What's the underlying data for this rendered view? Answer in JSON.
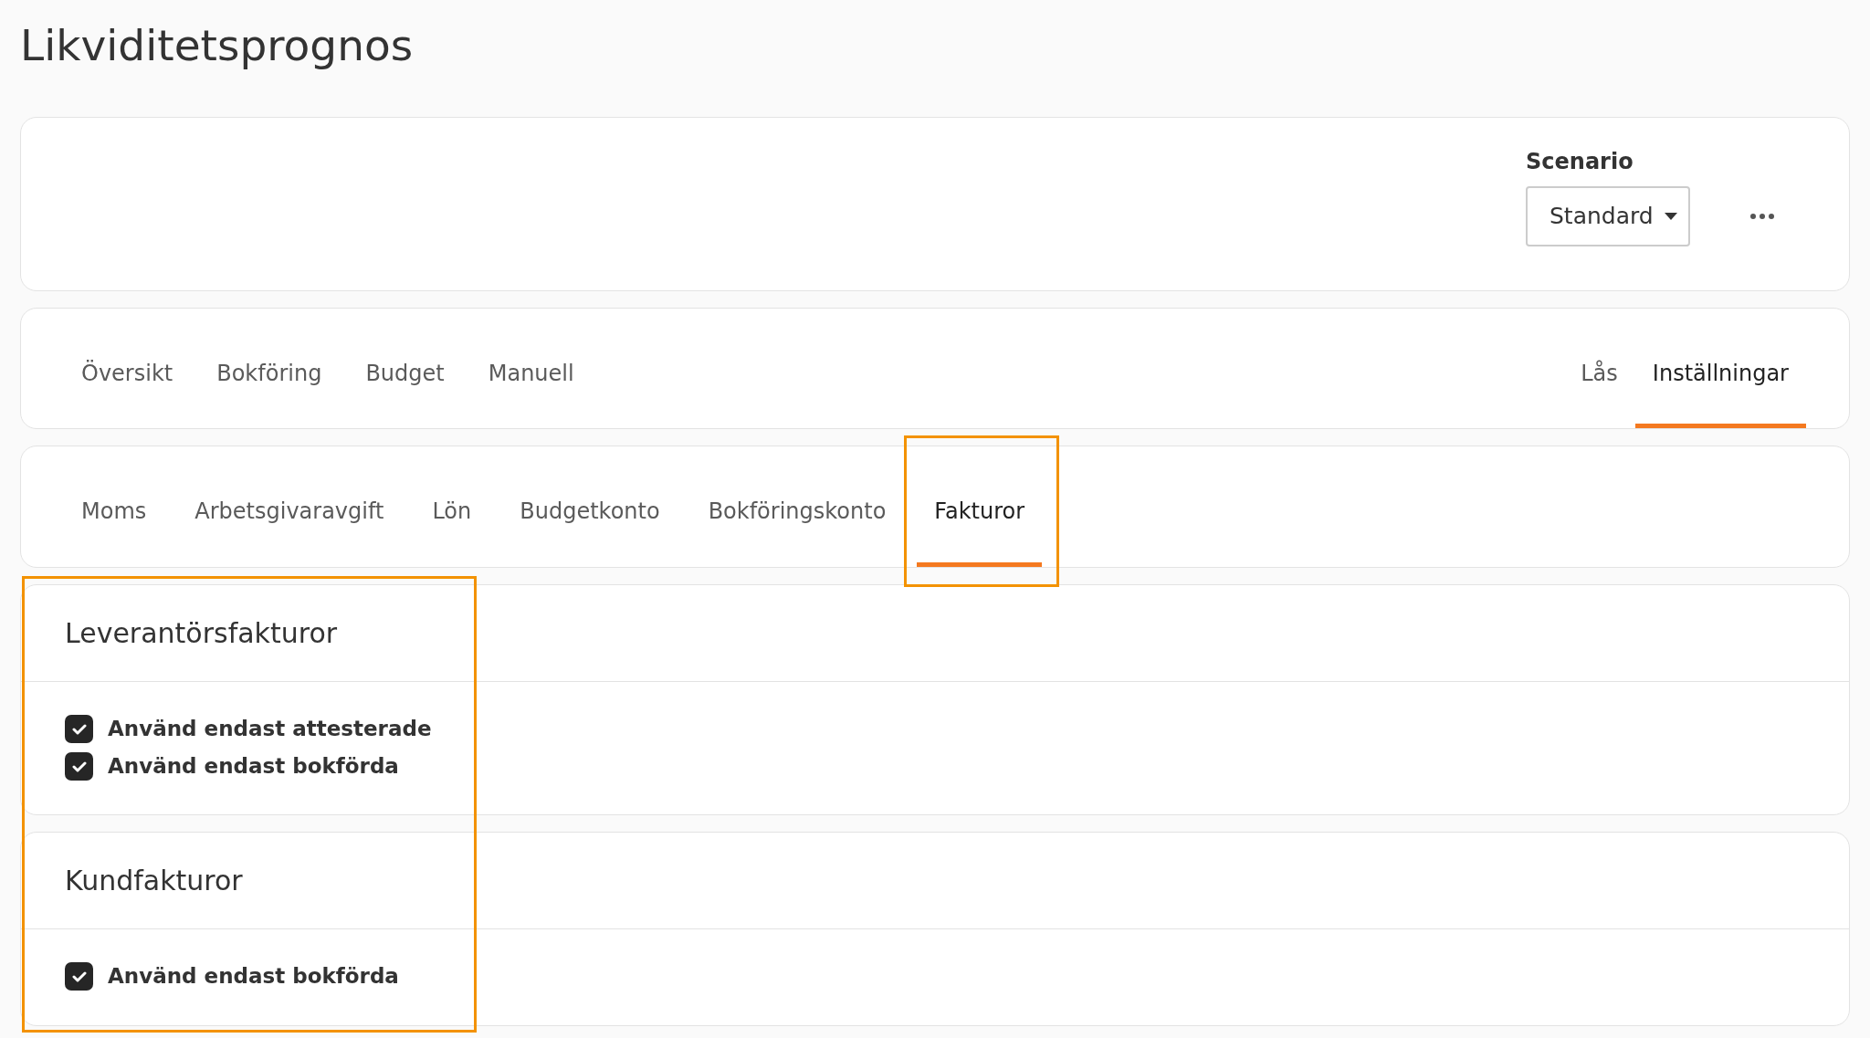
{
  "page": {
    "title": "Likviditetsprognos"
  },
  "scenario": {
    "label": "Scenario",
    "value": "Standard"
  },
  "main_tabs": {
    "left": [
      {
        "label": "Översikt",
        "selected": false
      },
      {
        "label": "Bokföring",
        "selected": false
      },
      {
        "label": "Budget",
        "selected": false
      },
      {
        "label": "Manuell",
        "selected": false
      }
    ],
    "right": [
      {
        "label": "Lås",
        "selected": false
      },
      {
        "label": "Inställningar",
        "selected": true
      }
    ]
  },
  "sub_tabs": [
    {
      "label": "Moms",
      "selected": false
    },
    {
      "label": "Arbetsgivaravgift",
      "selected": false
    },
    {
      "label": "Lön",
      "selected": false
    },
    {
      "label": "Budgetkonto",
      "selected": false
    },
    {
      "label": "Bokföringskonto",
      "selected": false
    },
    {
      "label": "Fakturor",
      "selected": true
    }
  ],
  "sections": [
    {
      "title": "Leverantörsfakturor",
      "options": [
        {
          "label": "Använd endast attesterade",
          "checked": true
        },
        {
          "label": "Använd endast bokförda",
          "checked": true
        }
      ]
    },
    {
      "title": "Kundfakturor",
      "options": [
        {
          "label": "Använd endast bokförda",
          "checked": true
        }
      ]
    }
  ]
}
